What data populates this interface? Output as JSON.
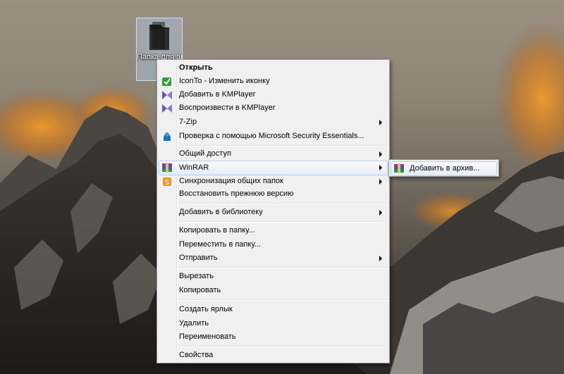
{
  "desktop": {
    "folder": {
      "icon": "folder-icon",
      "caption": "Папка для архива"
    }
  },
  "context_menu": {
    "items": [
      {
        "label": "Открыть",
        "icon": null,
        "default": true
      },
      {
        "label": "IconTo - Изменить иконку",
        "icon": "iconto-icon"
      },
      {
        "label": "Добавить в KMPlayer",
        "icon": "kmplayer-icon"
      },
      {
        "label": "Воспроизвести в KMPlayer",
        "icon": "kmplayer-icon"
      },
      {
        "label": "7-Zip",
        "icon": null,
        "submenu": true
      },
      {
        "label": "Проверка с помощью Microsoft Security Essentials...",
        "icon": "security-essentials-icon"
      },
      {
        "label": "Общий доступ",
        "icon": null,
        "submenu": true
      },
      {
        "label": "WinRAR",
        "icon": "winrar-icon",
        "submenu": true,
        "highlighted": true
      },
      {
        "label": "Синхронизация общих папок",
        "icon": "sync-icon",
        "submenu": true
      },
      {
        "label": "Восстановить прежнюю версию",
        "icon": null
      },
      {
        "label": "Добавить в библиотеку",
        "icon": null,
        "submenu": true
      },
      {
        "label": "Копировать в папку...",
        "icon": null
      },
      {
        "label": "Переместить в папку...",
        "icon": null
      },
      {
        "label": "Отправить",
        "icon": null,
        "submenu": true
      },
      {
        "label": "Вырезать",
        "icon": null
      },
      {
        "label": "Копировать",
        "icon": null
      },
      {
        "label": "Создать ярлык",
        "icon": null
      },
      {
        "label": "Удалить",
        "icon": null
      },
      {
        "label": "Переименовать",
        "icon": null
      },
      {
        "label": "Свойства",
        "icon": null
      }
    ]
  },
  "winrar_submenu": {
    "items": [
      {
        "label": "Добавить в архив...",
        "icon": "winrar-icon",
        "highlighted": true
      }
    ]
  },
  "colors": {
    "menu_background": "#f0f0f0",
    "menu_border": "#979797",
    "highlight_border": "#aecff7"
  }
}
